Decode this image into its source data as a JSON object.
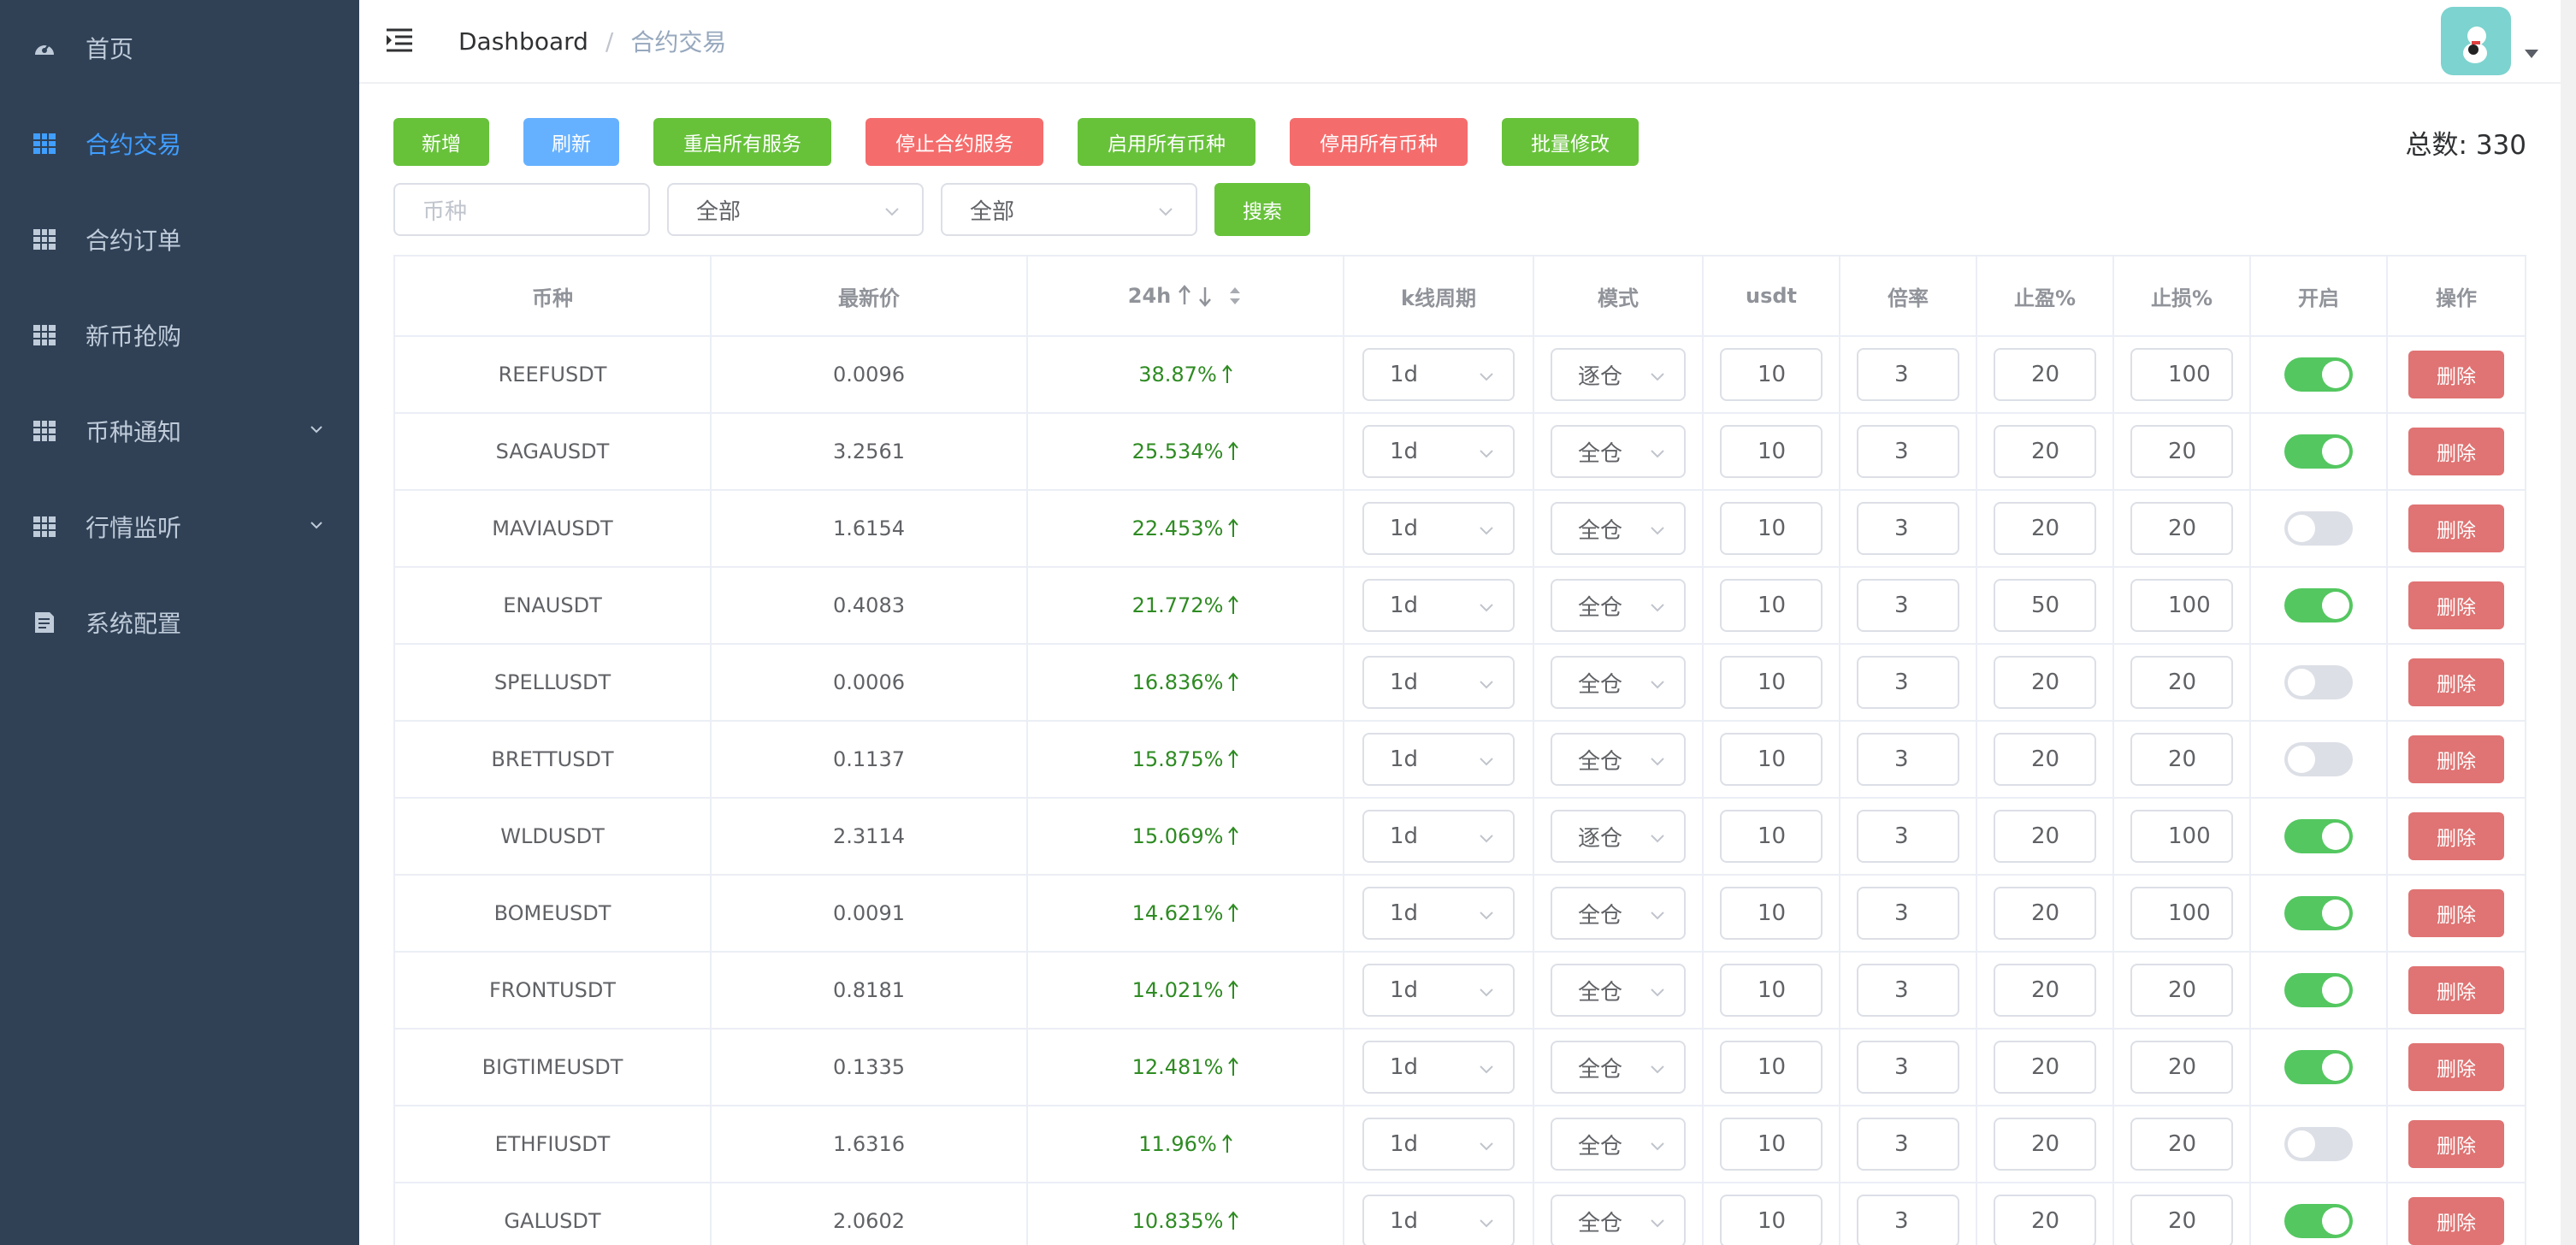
{
  "sidebar": {
    "items": [
      {
        "label": "首页",
        "icon": "dashboard-icon",
        "active": false,
        "expandable": false
      },
      {
        "label": "合约交易",
        "icon": "table-icon",
        "active": true,
        "expandable": false
      },
      {
        "label": "合约订单",
        "icon": "table-icon",
        "active": false,
        "expandable": false
      },
      {
        "label": "新币抢购",
        "icon": "table-icon",
        "active": false,
        "expandable": false
      },
      {
        "label": "币种通知",
        "icon": "table-icon",
        "active": false,
        "expandable": true
      },
      {
        "label": "行情监听",
        "icon": "table-icon",
        "active": false,
        "expandable": true
      },
      {
        "label": "系统配置",
        "icon": "document-icon",
        "active": false,
        "expandable": false
      }
    ]
  },
  "header": {
    "breadcrumb_home": "Dashboard",
    "breadcrumb_separator": "/",
    "breadcrumb_current": "合约交易"
  },
  "toolbar": {
    "add": "新增",
    "refresh": "刷新",
    "restart_all": "重启所有服务",
    "stop_contract": "停止合约服务",
    "enable_all": "启用所有币种",
    "disable_all": "停用所有币种",
    "batch_edit": "批量修改",
    "total": "总数: 330"
  },
  "filters": {
    "symbol_placeholder": "币种",
    "select1_value": "全部",
    "select2_value": "全部",
    "search": "搜索"
  },
  "table": {
    "headers": {
      "symbol": "币种",
      "price": "最新价",
      "change": "24h",
      "kline": "k线周期",
      "mode": "模式",
      "usdt": "usdt",
      "leverage": "倍率",
      "take_profit": "止盈%",
      "stop_loss": "止损%",
      "enabled": "开启",
      "action": "操作"
    },
    "delete_label": "删除",
    "rows": [
      {
        "symbol": "REEFUSDT",
        "price": "0.0096",
        "change": "38.87%",
        "kline": "1d",
        "mode": "逐仓",
        "usdt": "10",
        "leverage": "3",
        "tp": "20",
        "sl": "100",
        "enabled": true
      },
      {
        "symbol": "SAGAUSDT",
        "price": "3.2561",
        "change": "25.534%",
        "kline": "1d",
        "mode": "全仓",
        "usdt": "10",
        "leverage": "3",
        "tp": "20",
        "sl": "20",
        "enabled": true
      },
      {
        "symbol": "MAVIAUSDT",
        "price": "1.6154",
        "change": "22.453%",
        "kline": "1d",
        "mode": "全仓",
        "usdt": "10",
        "leverage": "3",
        "tp": "20",
        "sl": "20",
        "enabled": false
      },
      {
        "symbol": "ENAUSDT",
        "price": "0.4083",
        "change": "21.772%",
        "kline": "1d",
        "mode": "全仓",
        "usdt": "10",
        "leverage": "3",
        "tp": "50",
        "sl": "100",
        "enabled": true
      },
      {
        "symbol": "SPELLUSDT",
        "price": "0.0006",
        "change": "16.836%",
        "kline": "1d",
        "mode": "全仓",
        "usdt": "10",
        "leverage": "3",
        "tp": "20",
        "sl": "20",
        "enabled": false
      },
      {
        "symbol": "BRETTUSDT",
        "price": "0.1137",
        "change": "15.875%",
        "kline": "1d",
        "mode": "全仓",
        "usdt": "10",
        "leverage": "3",
        "tp": "20",
        "sl": "20",
        "enabled": false
      },
      {
        "symbol": "WLDUSDT",
        "price": "2.3114",
        "change": "15.069%",
        "kline": "1d",
        "mode": "逐仓",
        "usdt": "10",
        "leverage": "3",
        "tp": "20",
        "sl": "100",
        "enabled": true
      },
      {
        "symbol": "BOMEUSDT",
        "price": "0.0091",
        "change": "14.621%",
        "kline": "1d",
        "mode": "全仓",
        "usdt": "10",
        "leverage": "3",
        "tp": "20",
        "sl": "100",
        "enabled": true
      },
      {
        "symbol": "FRONTUSDT",
        "price": "0.8181",
        "change": "14.021%",
        "kline": "1d",
        "mode": "全仓",
        "usdt": "10",
        "leverage": "3",
        "tp": "20",
        "sl": "20",
        "enabled": true
      },
      {
        "symbol": "BIGTIMEUSDT",
        "price": "0.1335",
        "change": "12.481%",
        "kline": "1d",
        "mode": "全仓",
        "usdt": "10",
        "leverage": "3",
        "tp": "20",
        "sl": "20",
        "enabled": true
      },
      {
        "symbol": "ETHFIUSDT",
        "price": "1.6316",
        "change": "11.96%",
        "kline": "1d",
        "mode": "全仓",
        "usdt": "10",
        "leverage": "3",
        "tp": "20",
        "sl": "20",
        "enabled": false
      },
      {
        "symbol": "GALUSDT",
        "price": "2.0602",
        "change": "10.835%",
        "kline": "1d",
        "mode": "全仓",
        "usdt": "10",
        "leverage": "3",
        "tp": "20",
        "sl": "20",
        "enabled": true
      }
    ]
  },
  "colors": {
    "sidebar_bg": "#304156",
    "sidebar_text": "#bfcbd9",
    "active": "#409eff",
    "success": "#67c23a",
    "danger": "#f56c6c",
    "primary_light": "#66b1ff",
    "change_positive": "#2e8b22",
    "switch_on": "#54c760"
  }
}
